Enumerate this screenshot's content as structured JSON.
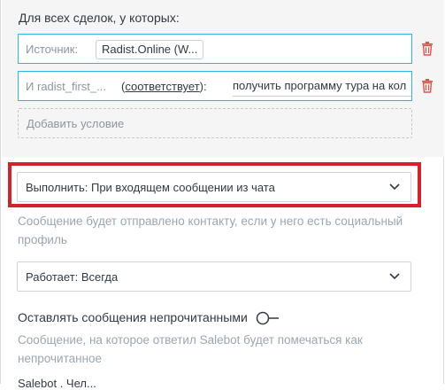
{
  "conditions": {
    "heading": "Для всех сделок, у которых:",
    "rows": [
      {
        "label": "Источник:",
        "value": "Radist.Online (W..."
      },
      {
        "label": "И radist_first_...",
        "operator": "соответствует",
        "operator_suffix": "):",
        "operator_prefix": "(",
        "value": "получить программу тура на кол"
      }
    ],
    "add_label": "Добавить условие"
  },
  "execute": {
    "select_value": "Выполнить: При входящем сообщении из чата",
    "hint": "Сообщение будет отправлено контакту, если у него есть социальный профиль"
  },
  "schedule": {
    "select_value": "Работает: Всегда"
  },
  "unread": {
    "label": "Оставлять сообщения непрочитанными",
    "enabled": false,
    "hint": "Сообщение, на которое ответил Salebot будет помечаться как непрочитанное"
  },
  "truncated_text": "Salebot . Чел...",
  "colors": {
    "accent": "#29b6e8",
    "highlight": "#d6212b",
    "delete": "#e5534b"
  }
}
